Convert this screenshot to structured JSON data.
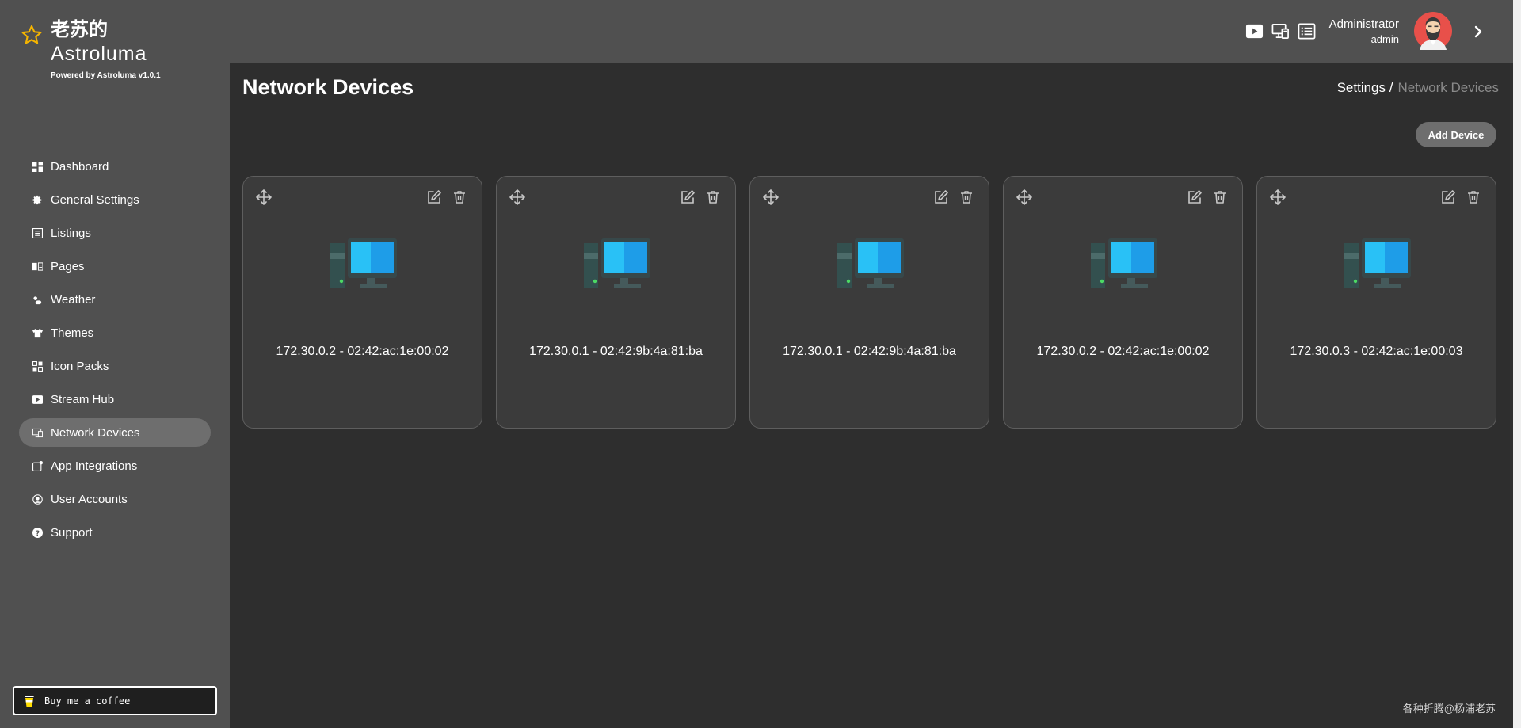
{
  "brand": {
    "title_line1": "老苏的",
    "title_line2": "Astroluma",
    "powered": "Powered by Astroluma v1.0.1"
  },
  "sidebar": {
    "items": [
      {
        "label": "Dashboard",
        "icon": "dashboard-icon"
      },
      {
        "label": "General Settings",
        "icon": "gear-icon"
      },
      {
        "label": "Listings",
        "icon": "listings-icon"
      },
      {
        "label": "Pages",
        "icon": "book-icon"
      },
      {
        "label": "Weather",
        "icon": "weather-icon"
      },
      {
        "label": "Themes",
        "icon": "shirt-icon"
      },
      {
        "label": "Icon Packs",
        "icon": "icon-pack-icon"
      },
      {
        "label": "Stream Hub",
        "icon": "play-icon"
      },
      {
        "label": "Network Devices",
        "icon": "network-device-icon",
        "active": true
      },
      {
        "label": "App Integrations",
        "icon": "app-integration-icon"
      },
      {
        "label": "User Accounts",
        "icon": "user-accounts-icon"
      },
      {
        "label": "Support",
        "icon": "support-icon"
      }
    ],
    "coffee_label": "Buy me a coffee"
  },
  "header": {
    "user_name": "Administrator",
    "user_role": "admin"
  },
  "main": {
    "title": "Network Devices",
    "breadcrumb_root": "Settings /",
    "breadcrumb_current": "Network Devices",
    "add_button": "Add Device",
    "devices": [
      {
        "label": "172.30.0.2 - 02:42:ac:1e:00:02"
      },
      {
        "label": "172.30.0.1 - 02:42:9b:4a:81:ba"
      },
      {
        "label": "172.30.0.1 - 02:42:9b:4a:81:ba"
      },
      {
        "label": "172.30.0.2 - 02:42:ac:1e:00:02"
      },
      {
        "label": "172.30.0.3 - 02:42:ac:1e:00:03"
      }
    ]
  },
  "footer": {
    "credit": "各种折腾@杨浦老苏"
  },
  "colors": {
    "sidebar_bg": "#505050",
    "main_bg": "#2e2e2e",
    "card_bg": "#3b3b3b",
    "active_nav": "#6e6e6e",
    "star": "#f5b400",
    "monitor_screen": "#29b6f6"
  }
}
